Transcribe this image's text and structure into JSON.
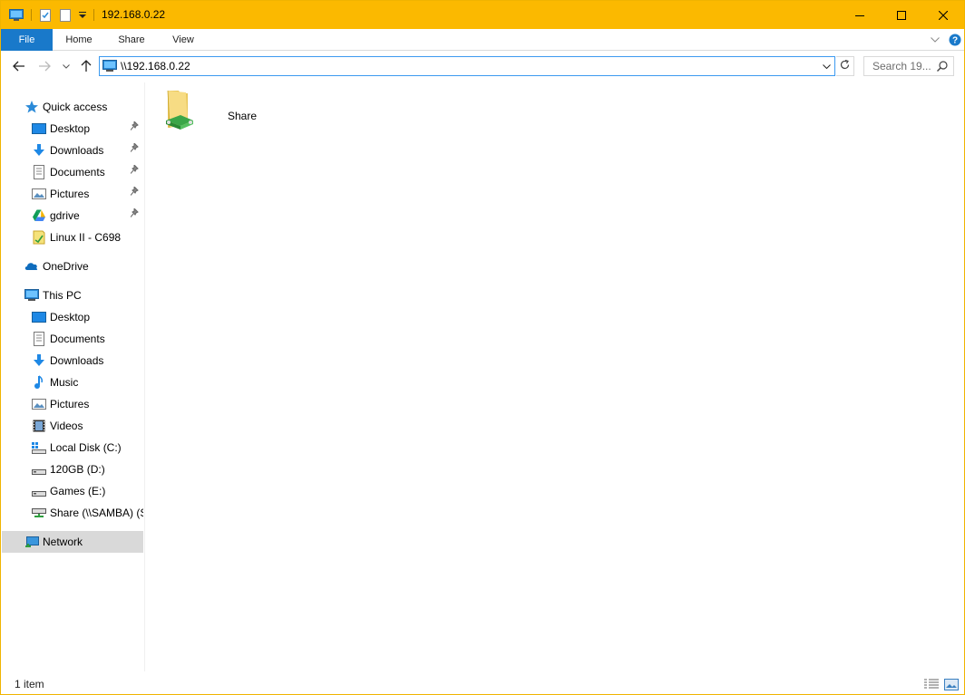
{
  "window": {
    "title": "192.168.0.22",
    "accent_color": "#fbb900"
  },
  "ribbon": {
    "tabs": [
      {
        "label": "File"
      },
      {
        "label": "Home"
      },
      {
        "label": "Share"
      },
      {
        "label": "View"
      }
    ]
  },
  "navigation": {
    "address": "\\\\192.168.0.22",
    "search_placeholder": "Search 19..."
  },
  "sidebar": {
    "quick_access": {
      "label": "Quick access",
      "items": [
        {
          "label": "Desktop",
          "icon": "desktop-icon",
          "pinned": true
        },
        {
          "label": "Downloads",
          "icon": "downloads-icon",
          "pinned": true
        },
        {
          "label": "Documents",
          "icon": "documents-icon",
          "pinned": true
        },
        {
          "label": "Pictures",
          "icon": "pictures-icon",
          "pinned": true
        },
        {
          "label": "gdrive",
          "icon": "google-drive-icon",
          "pinned": true
        },
        {
          "label": "Linux II - C698",
          "icon": "folder-shortcut-icon",
          "pinned": false
        }
      ]
    },
    "onedrive": {
      "label": "OneDrive"
    },
    "this_pc": {
      "label": "This PC",
      "items": [
        {
          "label": "Desktop",
          "icon": "desktop-icon"
        },
        {
          "label": "Documents",
          "icon": "documents-icon"
        },
        {
          "label": "Downloads",
          "icon": "downloads-icon"
        },
        {
          "label": "Music",
          "icon": "music-icon"
        },
        {
          "label": "Pictures",
          "icon": "pictures-icon"
        },
        {
          "label": "Videos",
          "icon": "videos-icon"
        },
        {
          "label": "Local Disk (C:)",
          "icon": "windows-drive-icon"
        },
        {
          "label": "120GB (D:)",
          "icon": "drive-icon"
        },
        {
          "label": "Games (E:)",
          "icon": "drive-icon"
        },
        {
          "label": "Share (\\\\SAMBA) (S",
          "icon": "network-drive-icon"
        }
      ]
    },
    "network": {
      "label": "Network",
      "selected": true
    }
  },
  "content": {
    "items": [
      {
        "label": "Share",
        "icon": "network-share-folder-icon"
      }
    ]
  },
  "status": {
    "item_count": "1 item"
  }
}
